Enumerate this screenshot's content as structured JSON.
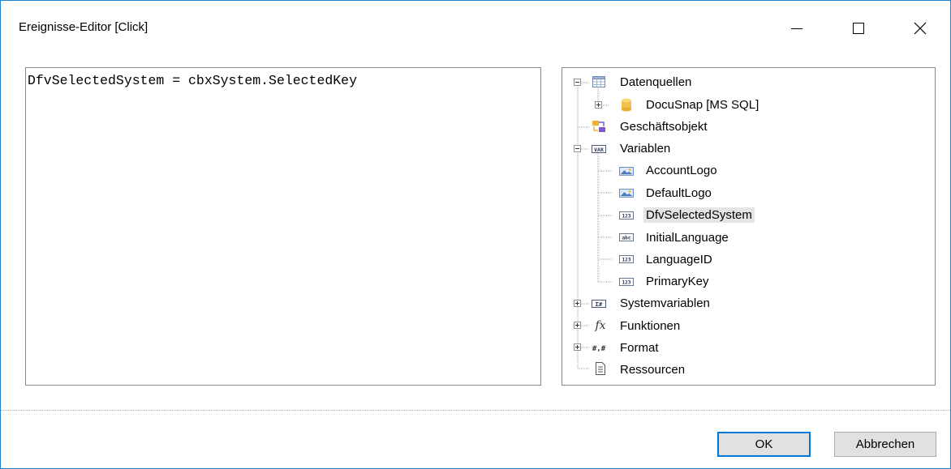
{
  "window": {
    "title": "Ereignisse-Editor [Click]",
    "accent_color": "#1883d7",
    "controls": [
      "minimize-icon",
      "maximize-icon",
      "close-icon"
    ]
  },
  "editor": {
    "code": "DfvSelectedSystem = cbxSystem.SelectedKey"
  },
  "tree": {
    "datenquellen": {
      "label": "Datenquellen",
      "icon": "table-icon",
      "expanded": true
    },
    "docusnap": {
      "label": "DocuSnap [MS SQL]",
      "icon": "database-icon",
      "expanded": false
    },
    "geschaeftsobjekt": {
      "label": "Geschäftsobjekt",
      "icon": "business-object-icon"
    },
    "variablen": {
      "label": "Variablen",
      "icon": "var-icon",
      "expanded": true
    },
    "accountlogo": {
      "label": "AccountLogo",
      "icon": "image-icon"
    },
    "defaultlogo": {
      "label": "DefaultLogo",
      "icon": "image-icon"
    },
    "dfvselectedsystem": {
      "label": "DfvSelectedSystem",
      "icon": "number-icon",
      "selected": true
    },
    "initiallanguage": {
      "label": "InitialLanguage",
      "icon": "string-icon"
    },
    "languageid": {
      "label": "LanguageID",
      "icon": "number-icon"
    },
    "primarykey": {
      "label": "PrimaryKey",
      "icon": "number-icon"
    },
    "systemvariablen": {
      "label": "Systemvariablen",
      "icon": "system-variable-icon",
      "expanded": false
    },
    "funktionen": {
      "label": "Funktionen",
      "icon": "function-icon",
      "expanded": false
    },
    "format": {
      "label": "Format",
      "icon": "format-icon",
      "expanded": false
    },
    "ressourcen": {
      "label": "Ressourcen",
      "icon": "resource-icon"
    }
  },
  "buttons": {
    "ok": "OK",
    "cancel": "Abbrechen"
  }
}
